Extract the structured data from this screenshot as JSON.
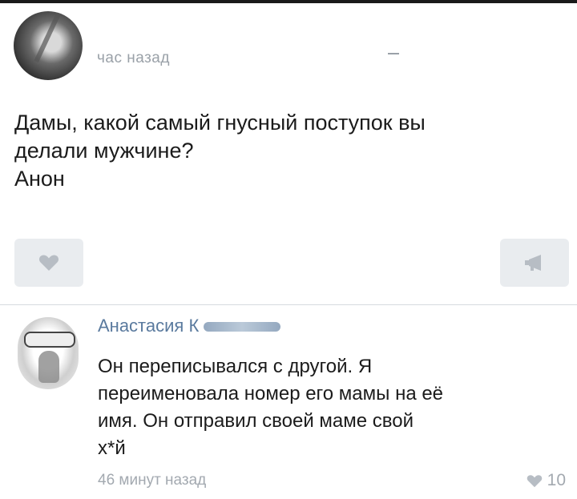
{
  "post": {
    "time": "час назад",
    "text_lines": [
      "Дамы, какой самый гнусный поступок вы",
      "делали мужчине?",
      "Анон"
    ]
  },
  "comment": {
    "author": "Анастасия К",
    "text_lines": [
      "Он переписывался с другой. Я",
      "переименовала номер его мамы на её",
      "имя. Он отправил своей маме свой",
      "х*й"
    ],
    "time": "46 минут назад",
    "likes": "10"
  },
  "icons": {
    "like": "heart-icon",
    "share": "megaphone-icon",
    "comment_like": "heart-icon"
  },
  "colors": {
    "author_link": "#5a7a9e",
    "meta_grey": "#a3a9b0",
    "button_bg": "#e9ecef"
  }
}
